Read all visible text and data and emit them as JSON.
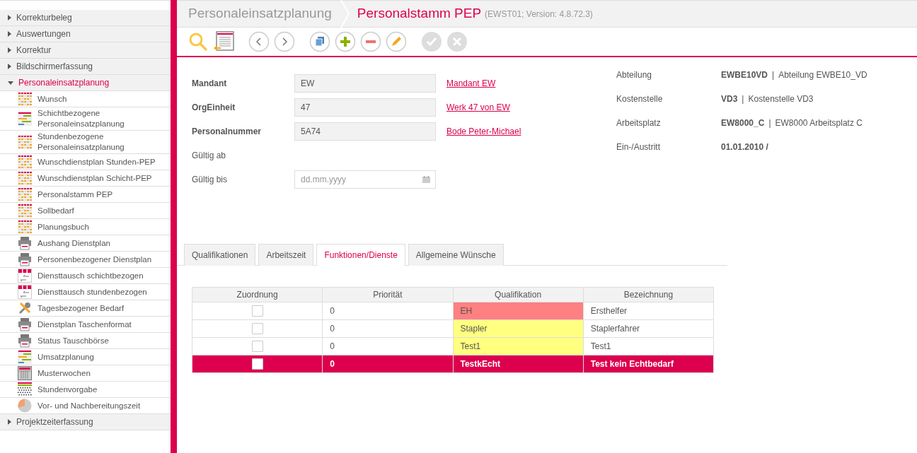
{
  "sidebar": {
    "groups": [
      {
        "label": "Korrekturbeleg",
        "expanded": false
      },
      {
        "label": "Auswertungen",
        "expanded": false
      },
      {
        "label": "Korrektur",
        "expanded": false
      },
      {
        "label": "Bildschirmerfassung",
        "expanded": false
      },
      {
        "label": "Personaleinsatzplanung",
        "expanded": true,
        "items": [
          {
            "label": "Wunsch",
            "kind": "grid"
          },
          {
            "label": "Schichtbezogene Personaleinsatzplanung",
            "kind": "bars"
          },
          {
            "label": "Stundenbezogene Personaleinsatzplanung",
            "kind": "grid"
          },
          {
            "label": "Wunschdienstplan Stunden-PEP",
            "kind": "grid"
          },
          {
            "label": "Wunschdienstplan Schicht-PEP",
            "kind": "grid"
          },
          {
            "label": "Personalstamm PEP",
            "kind": "grid"
          },
          {
            "label": "Sollbedarf",
            "kind": "grid"
          },
          {
            "label": "Planungsbuch",
            "kind": "grid"
          },
          {
            "label": "Aushang Dienstplan",
            "kind": "printer"
          },
          {
            "label": "Personenbezogener Dienstplan",
            "kind": "printer"
          },
          {
            "label": "Diensttausch schichtbezogen",
            "kind": "swap"
          },
          {
            "label": "Diensttausch stundenbezogen",
            "kind": "swap"
          },
          {
            "label": "Tagesbezogener Bedarf",
            "kind": "wrench"
          },
          {
            "label": "Dienstplan Taschenformat",
            "kind": "printer"
          },
          {
            "label": "Status Tauschbörse",
            "kind": "printer"
          },
          {
            "label": "Umsatzplanung",
            "kind": "bars"
          },
          {
            "label": "Musterwochen",
            "kind": "calendar"
          },
          {
            "label": "Stundenvorgabe",
            "kind": "dots"
          },
          {
            "label": "Vor- und Nachbereitungszeit",
            "kind": "pie"
          }
        ]
      },
      {
        "label": "Projektzeiterfassung",
        "expanded": false
      }
    ]
  },
  "breadcrumb": {
    "parent": "Personaleinsatzplanung",
    "title": "Personalstamm PEP",
    "version": "(EWST01; Version: 4.8.72.3)"
  },
  "toolbar": [
    {
      "kind": "search",
      "disabled": false
    },
    {
      "kind": "list",
      "disabled": false
    },
    {
      "kind": "prev",
      "disabled": false
    },
    {
      "kind": "next",
      "disabled": false
    },
    {
      "kind": "copy",
      "disabled": false
    },
    {
      "kind": "add",
      "disabled": false
    },
    {
      "kind": "remove",
      "disabled": false
    },
    {
      "kind": "edit",
      "disabled": false
    },
    {
      "kind": "save",
      "disabled": true
    },
    {
      "kind": "cancel",
      "disabled": true
    }
  ],
  "form": [
    {
      "label": "Mandant",
      "required": true,
      "value": "EW",
      "link": "Mandant EW"
    },
    {
      "label": "OrgEinheit",
      "required": true,
      "value": "47",
      "link": "Werk 47 von EW"
    },
    {
      "label": "Personalnummer",
      "required": true,
      "value": "5A74",
      "link": "Bode Peter-Michael"
    },
    {
      "label": "Gültig ab",
      "required": false
    },
    {
      "label": "Gültig bis",
      "required": false,
      "placeholder": "dd.mm.yyyy",
      "date": true
    }
  ],
  "info": [
    {
      "label": "Abteilung",
      "code": "EWBE10VD",
      "separator": "|",
      "description": "Abteilung EWBE10_VD"
    },
    {
      "label": "Kostenstelle",
      "code": "VD3",
      "separator": "|",
      "description": "Kostenstelle VD3"
    },
    {
      "label": "Arbeitsplatz",
      "code": "EW8000_C",
      "separator": "|",
      "description": "EW8000 Arbeitsplatz C"
    },
    {
      "label": "Ein-/Austritt",
      "code": "01.01.2010 /"
    }
  ],
  "tabs": [
    {
      "label": "Qualifikationen",
      "selected": false
    },
    {
      "label": "Arbeitszeit",
      "selected": false
    },
    {
      "label": "Funktionen/Dienste",
      "selected": true
    },
    {
      "label": "Allgemeine Wünsche",
      "selected": false
    }
  ],
  "table": {
    "columns": [
      "Zuordnung",
      "Priorität",
      "Qualifikation",
      "Bezeichnung"
    ],
    "rows": [
      {
        "checked": false,
        "priority": "0",
        "qualification": "EH",
        "color": "#ff8080",
        "description": "Ersthelfer",
        "selected": false
      },
      {
        "checked": false,
        "priority": "0",
        "qualification": "Stapler",
        "color": "#ffff80",
        "description": "Staplerfahrer",
        "selected": false
      },
      {
        "checked": false,
        "priority": "0",
        "qualification": "Test1",
        "color": "#ffff80",
        "description": "Test1",
        "selected": false
      },
      {
        "checked": false,
        "priority": "0",
        "qualification": "TestkEcht",
        "description": "Test kein Echtbedarf",
        "selected": true
      }
    ]
  }
}
